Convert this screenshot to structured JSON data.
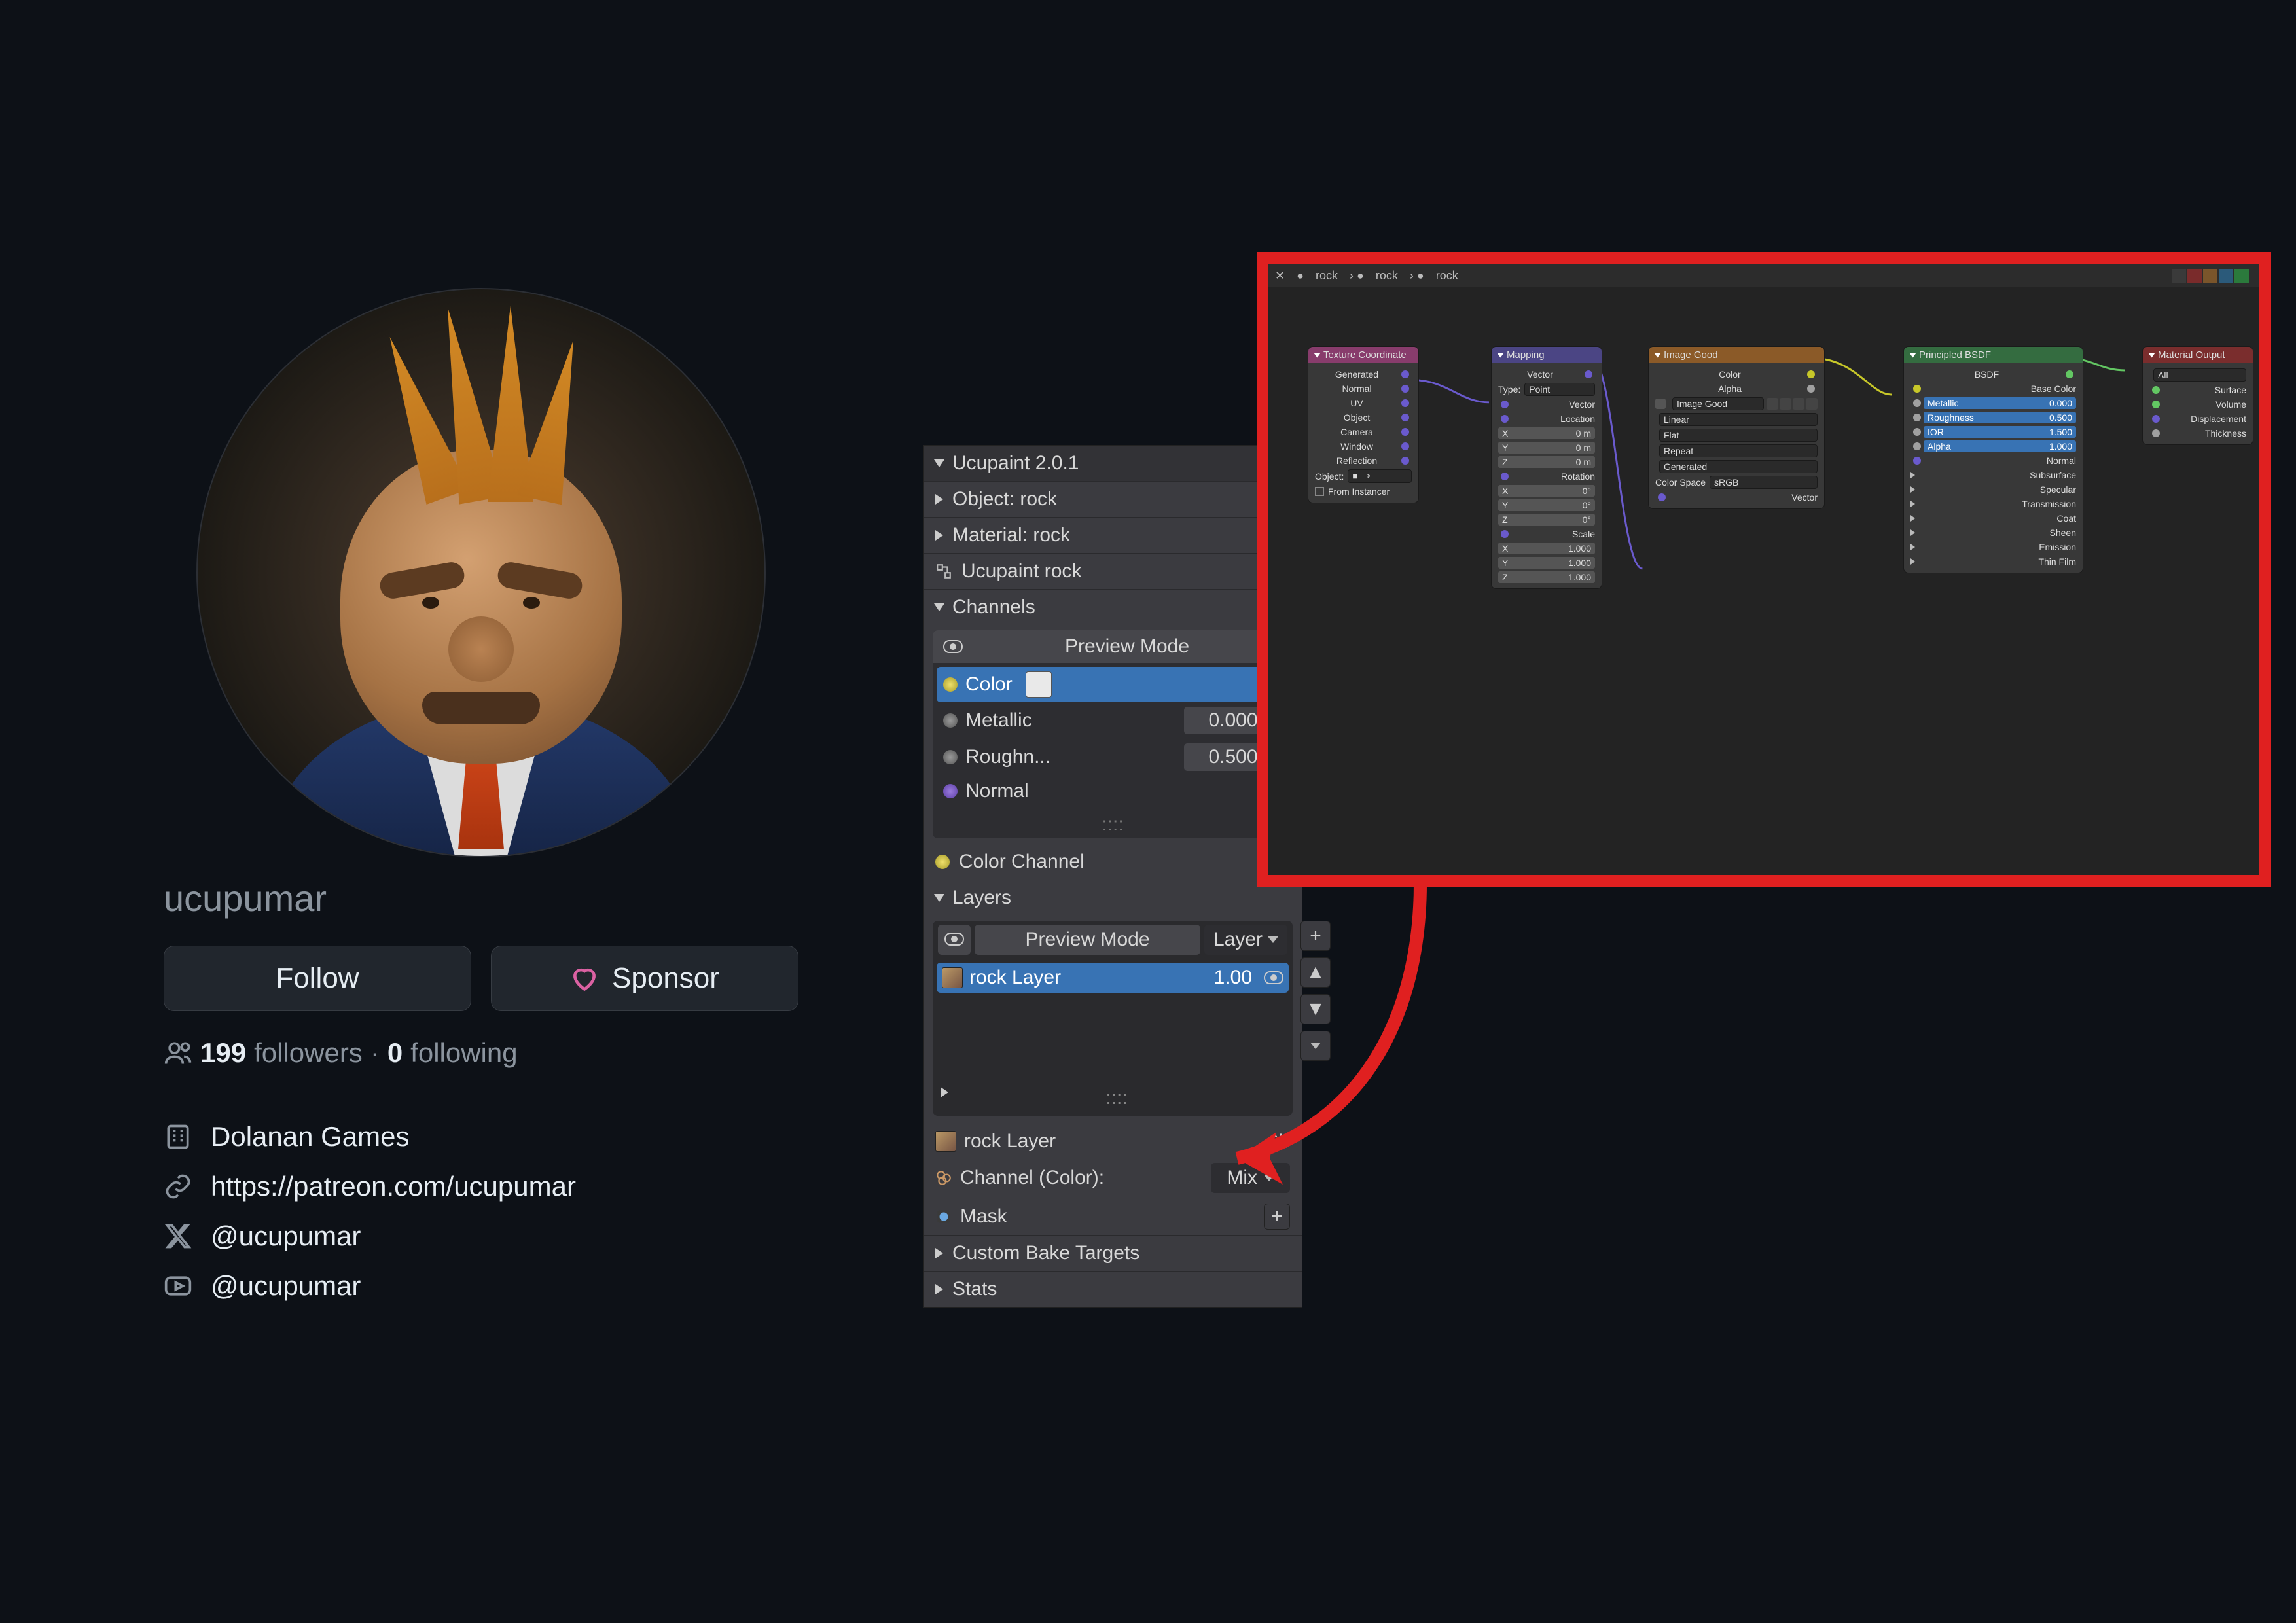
{
  "profile": {
    "username": "ucupumar",
    "follow_label": "Follow",
    "sponsor_label": "Sponsor",
    "followers_count": "199",
    "followers_label": "followers",
    "following_count": "0",
    "following_label": "following",
    "org": "Dolanan Games",
    "website": "https://patreon.com/ucupumar",
    "x_handle": "@ucupumar",
    "youtube_handle": "@ucupumar"
  },
  "ucupaint": {
    "title": "Ucupaint 2.0.1",
    "object_label": "Object: rock",
    "material_label": "Material: rock",
    "root_label": "Ucupaint rock",
    "channels_label": "Channels",
    "preview_mode": "Preview Mode",
    "channels": [
      {
        "name": "Color",
        "value": ""
      },
      {
        "name": "Metallic",
        "value": "0.000"
      },
      {
        "name": "Roughn...",
        "value": "0.500"
      },
      {
        "name": "Normal",
        "value": ""
      }
    ],
    "color_channel_label": "Color Channel",
    "layers_label": "Layers",
    "layer_mode": "Layer",
    "layer_name": "rock Layer",
    "layer_value": "1.00",
    "footer_layer": "rock Layer",
    "channel_mix_label": "Channel (Color):",
    "mix_mode": "Mix",
    "mask_label": "Mask",
    "bake_label": "Custom Bake Targets",
    "stats_label": "Stats"
  },
  "node_editor": {
    "breadcrumb": [
      "rock",
      "rock",
      "rock"
    ],
    "mode_colors": [
      "#3a3a3a",
      "#7a2b2b",
      "#7a552b",
      "#2b5a7a",
      "#2b7a3c"
    ],
    "tex_coord": {
      "title": "Texture Coordinate",
      "outs": [
        "Generated",
        "Normal",
        "UV",
        "Object",
        "Camera",
        "Window",
        "Reflection"
      ],
      "object_label": "Object:",
      "from_instancer": "From Instancer"
    },
    "mapping": {
      "title": "Mapping",
      "vector_out": "Vector",
      "type_label": "Type:",
      "type_value": "Point",
      "vector_in": "Vector",
      "groups": [
        {
          "label": "Location",
          "x": "0 m",
          "y": "0 m",
          "z": "0 m"
        },
        {
          "label": "Rotation",
          "x": "0°",
          "y": "0°",
          "z": "0°"
        },
        {
          "label": "Scale",
          "x": "1.000",
          "y": "1.000",
          "z": "1.000"
        }
      ]
    },
    "image": {
      "title": "Image Good",
      "color_out": "Color",
      "alpha_out": "Alpha",
      "img_name": "Image Good",
      "interp": "Linear",
      "proj": "Flat",
      "ext": "Repeat",
      "src": "Generated",
      "cs_label": "Color Space",
      "cs_value": "sRGB",
      "vector_in": "Vector"
    },
    "bsdf": {
      "title": "Principled BSDF",
      "bsdf_out": "BSDF",
      "base_color": "Base Color",
      "rows": [
        {
          "name": "Metallic",
          "val": "0.000"
        },
        {
          "name": "Roughness",
          "val": "0.500"
        },
        {
          "name": "IOR",
          "val": "1.500"
        },
        {
          "name": "Alpha",
          "val": "1.000"
        }
      ],
      "normal": "Normal",
      "groups": [
        "Subsurface",
        "Specular",
        "Transmission",
        "Coat",
        "Sheen",
        "Emission",
        "Thin Film"
      ]
    },
    "output": {
      "title": "Material Output",
      "target": "All",
      "ins": [
        "Surface",
        "Volume",
        "Displacement",
        "Thickness"
      ]
    }
  }
}
